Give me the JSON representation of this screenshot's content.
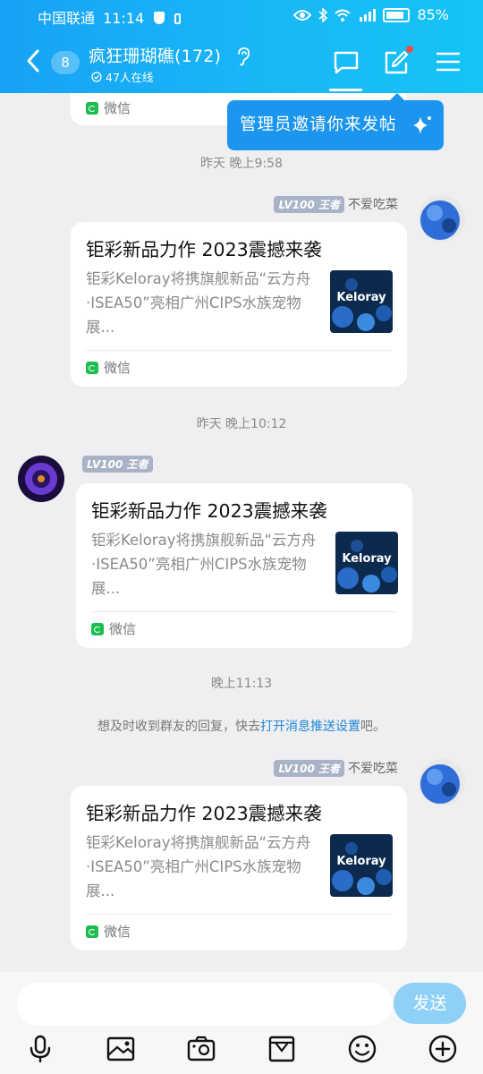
{
  "status": {
    "carrier": "中国联通",
    "time": "11:14",
    "battery": "85%"
  },
  "header": {
    "unread": "8",
    "group_title": "疯狂珊瑚礁(172)",
    "online": "47人在线"
  },
  "tooltip": "管理员邀请你来发帖",
  "messages": [
    {
      "source": "微信"
    },
    {
      "time": "昨天 晚上9:58",
      "level": "LV100 王者",
      "sender": "不爱吃菜",
      "title": "钜彩新品力作 2023震撼来袭",
      "desc": "钜彩Keloray将携旗舰新品“云方舟·ISEA50”亮相广州CIPS水族宠物展...",
      "thumb_text": "Keloray",
      "source": "微信"
    },
    {
      "time": "昨天 晚上10:12",
      "level": "LV100 王者",
      "sender": "",
      "title": "钜彩新品力作 2023震撼来袭",
      "desc": "钜彩Keloray将携旗舰新品“云方舟·ISEA50”亮相广州CIPS水族宠物展...",
      "thumb_text": "Keloray",
      "source": "微信"
    },
    {
      "time": "晚上11:13",
      "level": "LV100 王者",
      "sender": "不爱吃菜",
      "title": "钜彩新品力作 2023震撼来袭",
      "desc": "钜彩Keloray将携旗舰新品“云方舟·ISEA50”亮相广州CIPS水族宠物展...",
      "thumb_text": "Keloray",
      "source": "微信"
    }
  ],
  "notice": {
    "before": "想及时收到群友的回复，快去",
    "link": "打开消息推送设置",
    "after": "吧。"
  },
  "input": {
    "placeholder": "",
    "send_label": "发送"
  },
  "colors": {
    "accent": "#17a2f5",
    "link": "#1d86d8",
    "send": "#8fd0f7"
  },
  "icons": {
    "toolbar": [
      "mic-icon",
      "image-icon",
      "camera-icon",
      "mailbox-icon",
      "emoji-icon",
      "plus-icon"
    ]
  }
}
